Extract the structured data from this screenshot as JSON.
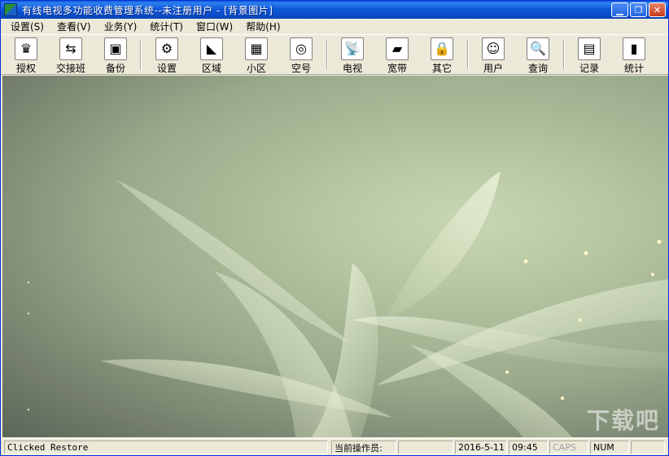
{
  "window": {
    "title": "有线电视多功能收费管理系统--未注册用户 - [背景图片]",
    "buttons": {
      "minimize": "▁",
      "restore": "❐",
      "close": "✕"
    }
  },
  "menu": [
    {
      "label": "设置(S)"
    },
    {
      "label": "查看(V)"
    },
    {
      "label": "业务(Y)"
    },
    {
      "label": "统计(T)"
    },
    {
      "label": "窗口(W)"
    },
    {
      "label": "帮助(H)"
    }
  ],
  "toolbar": {
    "auth": {
      "label": "授权",
      "icon": "crown-icon",
      "glyph": "♛"
    },
    "shift": {
      "label": "交接班",
      "icon": "swap-icon",
      "glyph": "⇆"
    },
    "backup": {
      "label": "备份",
      "icon": "floppy-icon",
      "glyph": "▣"
    },
    "settings": {
      "label": "设置",
      "icon": "gear-icon",
      "glyph": "⚙"
    },
    "area": {
      "label": "区域",
      "icon": "area-icon",
      "glyph": "◣"
    },
    "district": {
      "label": "小区",
      "icon": "district-icon",
      "glyph": "▦"
    },
    "vacant": {
      "label": "空号",
      "icon": "target-icon",
      "glyph": "◎"
    },
    "tv": {
      "label": "电视",
      "icon": "satellite-icon",
      "glyph": "📡"
    },
    "broadband": {
      "label": "宽带",
      "icon": "monitor-icon",
      "glyph": "▰"
    },
    "other": {
      "label": "其它",
      "icon": "lock-icon",
      "glyph": "🔒"
    },
    "user": {
      "label": "用户",
      "icon": "smiley-icon",
      "glyph": "☺"
    },
    "query": {
      "label": "查询",
      "icon": "magnifier-icon",
      "glyph": "🔍"
    },
    "record": {
      "label": "记录",
      "icon": "notebook-icon",
      "glyph": "▤"
    },
    "stats": {
      "label": "统计",
      "icon": "bar-chart-icon",
      "glyph": "▮"
    }
  },
  "status": {
    "message": "Clicked Restore",
    "operator_label": "当前操作员:",
    "operator_value": "",
    "date": "2016-5-11",
    "time": "09:45",
    "caps": "CAPS",
    "num": "NUM"
  },
  "watermark": "下载吧"
}
